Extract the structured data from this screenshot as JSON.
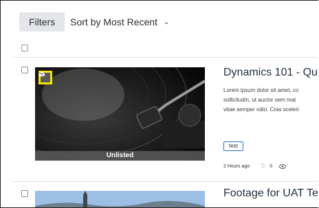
{
  "toolbar": {
    "filters_label": "Filters",
    "sort_label": "Sort by Most Recent",
    "sort_icon": "chevron-down-icon"
  },
  "items": [
    {
      "title": "Dynamics 101 - Qu",
      "description": "Lorem ipsum dolor sit amet, co\nsollicitudin, ut auctor sem mat\nvitae semper odio. Cras sceleri",
      "visibility": "Unlisted",
      "tag": "test",
      "age": "2 Hours ago",
      "likes": "0",
      "badge_icon": "cube-icon",
      "badge_color": "#f3e500"
    },
    {
      "title": "Footage for UAT Te"
    }
  ]
}
